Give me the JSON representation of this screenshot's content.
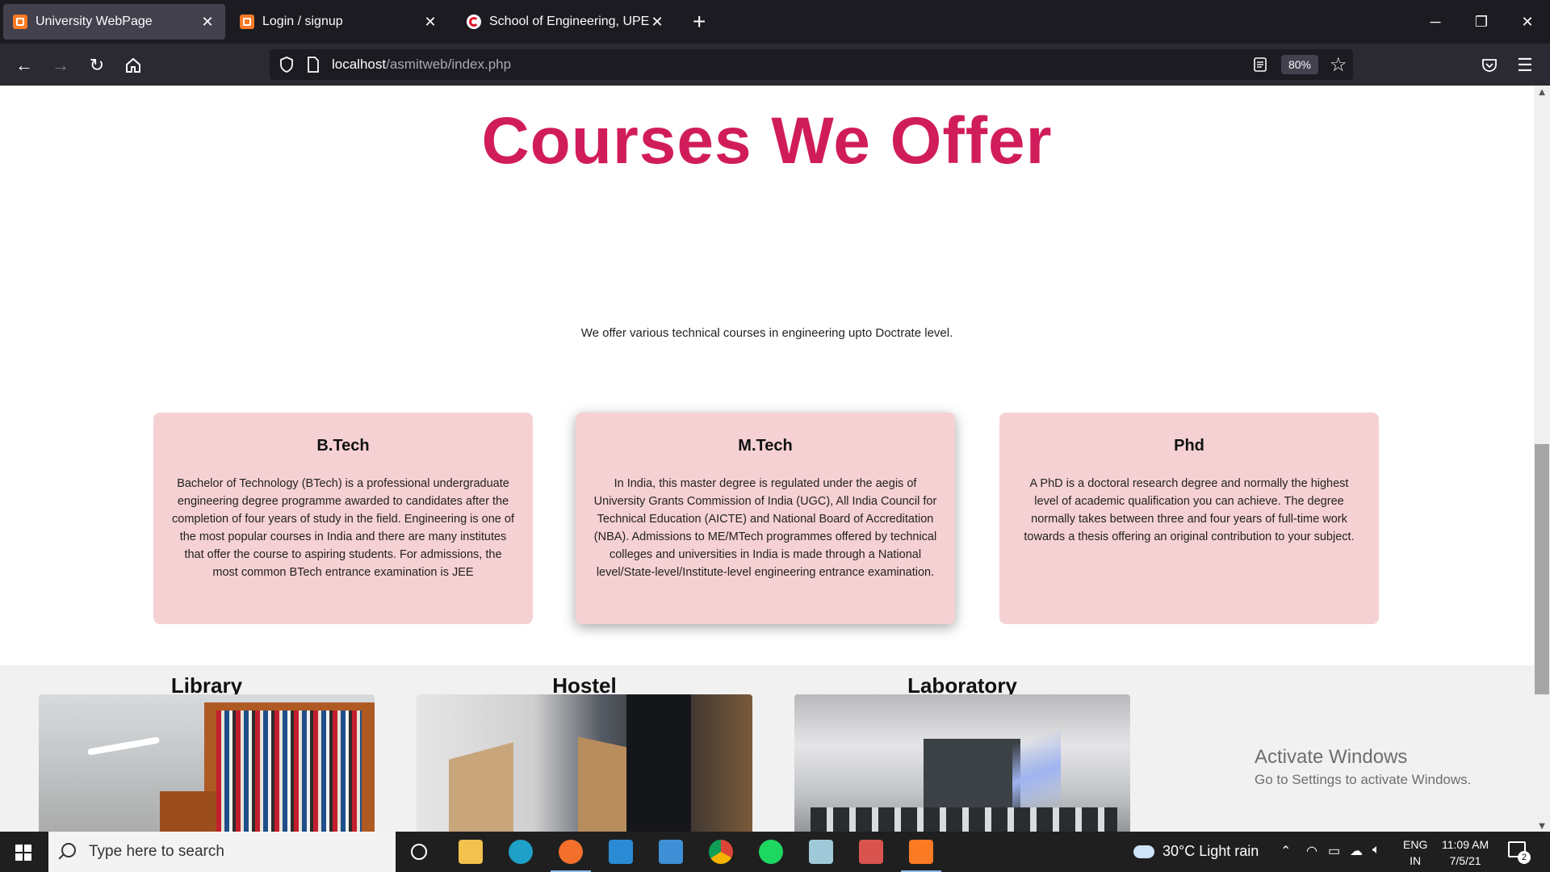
{
  "browser": {
    "tabs": [
      {
        "title": "University WebPage",
        "active": true,
        "icon": "xampp-icon"
      },
      {
        "title": "Login / signup",
        "active": false,
        "icon": "xampp-icon"
      },
      {
        "title": "School of Engineering, UPES De",
        "active": false,
        "icon": "upes-icon"
      }
    ],
    "url_host": "localhost",
    "url_path": "/asmitweb/index.php",
    "zoom": "80%"
  },
  "page": {
    "heading": "Courses We Offer",
    "intro": "We offer various technical courses in engineering upto Doctrate level.",
    "courses": [
      {
        "title": "B.Tech",
        "description": "Bachelor of Technology (BTech) is a professional undergraduate engineering degree programme awarded to candidates after the completion of four years of study in the field. Engineering is one of the most popular courses in India and there are many institutes that offer the course to aspiring students. For admissions, the most common BTech entrance examination is JEE"
      },
      {
        "title": "M.Tech",
        "description": "In India, this master degree is regulated under the aegis of University Grants Commission of India (UGC), All India Council for Technical Education (AICTE) and National Board of Accreditation (NBA). Admissions to ME/MTech programmes offered by technical colleges and universities in India is made through a National level/State-level/Institute-level engineering entrance examination."
      },
      {
        "title": "Phd",
        "description": "A PhD is a doctoral research degree and normally the highest level of academic qualification you can achieve. The degree normally takes between three and four years of full-time work towards a thesis offering an original contribution to your subject."
      }
    ],
    "facilities": [
      {
        "label": "Library"
      },
      {
        "label": "Hostel"
      },
      {
        "label": "Laboratory"
      }
    ]
  },
  "watermark": {
    "line1": "Activate Windows",
    "line2": "Go to Settings to activate Windows."
  },
  "taskbar": {
    "search_placeholder": "Type here to search",
    "weather": "30°C  Light rain",
    "lang_1": "ENG",
    "lang_2": "IN",
    "time": "11:09 AM",
    "date": "7/5/21",
    "notifications": "2"
  },
  "colors": {
    "heading": "#d11c5b",
    "card_bg": "#f6d1d3"
  }
}
